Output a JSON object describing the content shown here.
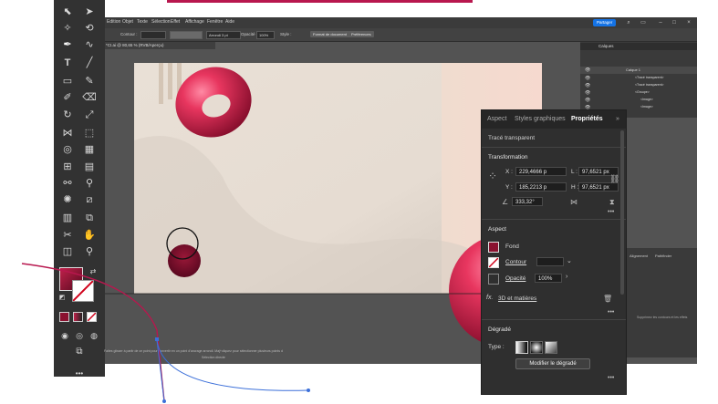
{
  "menubar": {
    "items": [
      "Edition",
      "Objet",
      "Texte",
      "Sélection",
      "Effet",
      "Affichage",
      "Fenêtre",
      "Aide"
    ],
    "share_label": "Partager"
  },
  "control_bar": {
    "object_label": "Contour :",
    "brush_label": "Arrondi 3 pt",
    "opacity_label": "Opacité :",
    "opacity_value": "100%",
    "style_label": "Style :",
    "doc_format_btn": "Format de document",
    "prefs_btn": "Préférences"
  },
  "doc_tab": {
    "title": "*CI.ai @ 80,65 % (RVB/Aperçu)"
  },
  "layers_panel": {
    "tab": "Calques",
    "rows": [
      "Calque 1",
      "<Tracé transparent>",
      "<Tracé transparent>",
      "<Groupe>",
      "<Image>",
      "<Image>"
    ]
  },
  "properties_panel": {
    "tabs": [
      "Aspect",
      "Styles graphiques",
      "Propriétés"
    ],
    "object_type": "Tracé transparent",
    "transform": {
      "title": "Transformation",
      "x_label": "X :",
      "x_value": "229,4666 p",
      "y_label": "Y :",
      "y_value": "185,2213 p",
      "w_label": "L :",
      "w_value": "97,6521 px",
      "h_label": "H :",
      "h_value": "97,6521 px",
      "angle_value": "333,32°"
    },
    "appearance": {
      "title": "Aspect",
      "fill_label": "Fond",
      "stroke_label": "Contour",
      "opacity_label": "Opacité",
      "opacity_value": "100%",
      "fx_label": "3D et matières"
    },
    "gradient": {
      "title": "Dégradé",
      "type_label": "Type :",
      "edit_button": "Modifier le dégradé"
    }
  },
  "right_panel2": {
    "tabs": [
      "Alignement",
      "Pathfinder"
    ],
    "hint": "Supprimez les contours et les effets"
  },
  "status_bar": {
    "text": "Faites glisser à partir de ce point pour convertir en un point d'ancrage arrondi. Maj+cliquez pour sélectionner plusieurs points d'ancrage en tracé",
    "selection_label": "Sélection directe"
  },
  "colors": {
    "accent_blue": "#1473e6",
    "torus_pink": "#e8365f",
    "torus_dark": "#8a0f2e",
    "canvas_bg": "#ece3db",
    "fill_swatch": "#8a1230"
  }
}
